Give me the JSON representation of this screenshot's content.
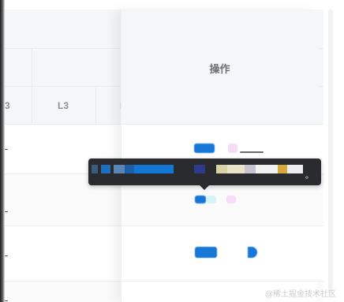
{
  "table": {
    "header_l3": "L3",
    "header_partial_left": "3",
    "header_partial_right": "l",
    "actions_header": "操作"
  },
  "tooltip": {
    "end_mark": "。"
  },
  "watermark": "@稀土掘金技术社区",
  "colors": {
    "action_blue": "#1677d8",
    "action_pink": "#f6dcf7",
    "action_cyan": "#d8f3f7",
    "tooltip_bg": "#2a2b2e",
    "header_bg": "#f5f6f8"
  }
}
